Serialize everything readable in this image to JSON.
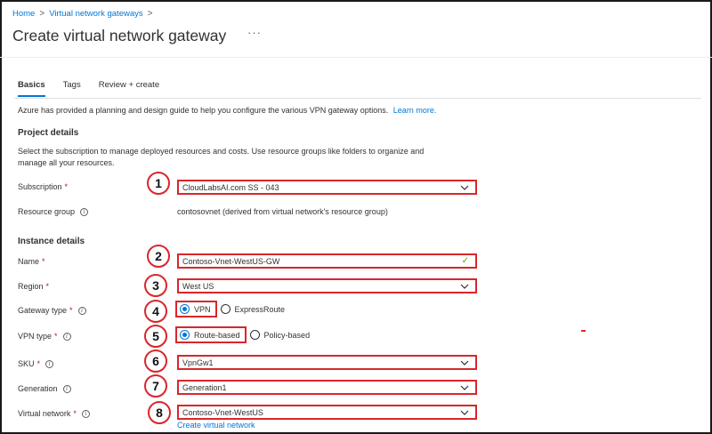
{
  "breadcrumb": {
    "home": "Home",
    "gateways": "Virtual network gateways",
    "separator": ">"
  },
  "page": {
    "title": "Create virtual network gateway",
    "more": "···"
  },
  "tabs": [
    {
      "label": "Basics",
      "active": true
    },
    {
      "label": "Tags"
    },
    {
      "label": "Review + create"
    }
  ],
  "intro": {
    "text": "Azure has provided a planning and design guide to help you configure the various VPN gateway options.",
    "link": "Learn more."
  },
  "project": {
    "heading": "Project details",
    "description": "Select the subscription to manage deployed resources and costs. Use resource groups like folders to organize and manage all your resources."
  },
  "instance": {
    "heading": "Instance details"
  },
  "fields": {
    "subscription": {
      "label": "Subscription",
      "required": "*",
      "value": "CloudLabsAI.com SS - 043",
      "marker": "1"
    },
    "resource_group": {
      "label": "Resource group",
      "value": "contosovnet (derived from virtual network's resource group)"
    },
    "name": {
      "label": "Name",
      "required": "*",
      "value": "Contoso-Vnet-WestUS-GW",
      "marker": "2"
    },
    "region": {
      "label": "Region",
      "required": "*",
      "value": "West US",
      "marker": "3"
    },
    "gateway_type": {
      "label": "Gateway type",
      "required": "*",
      "selected": "VPN",
      "other": "ExpressRoute",
      "marker": "4"
    },
    "vpn_type": {
      "label": "VPN type",
      "required": "*",
      "selected": "Route-based",
      "other": "Policy-based",
      "marker": "5"
    },
    "sku": {
      "label": "SKU",
      "required": "*",
      "value": "VpnGw1",
      "marker": "6"
    },
    "generation": {
      "label": "Generation",
      "value": "Generation1",
      "marker": "7"
    },
    "virtual_network": {
      "label": "Virtual network",
      "required": "*",
      "value": "Contoso-Vnet-WestUS",
      "marker": "8",
      "create_link": "Create virtual network"
    }
  },
  "icons": {
    "info": "info-icon",
    "chevron": "chevron-down-icon",
    "check": "checkmark-icon"
  },
  "colors": {
    "accent": "#0078d4",
    "highlight": "#d9262a",
    "required": "#a4262c",
    "valid": "#57a300"
  }
}
